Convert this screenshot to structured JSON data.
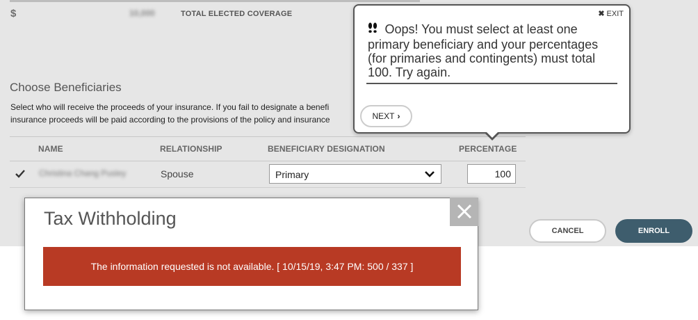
{
  "coverage": {
    "currency": "$",
    "amount": "10,000",
    "label": "TOTAL ELECTED COVERAGE"
  },
  "beneficiaries": {
    "title": "Choose Beneficiaries",
    "description_line1": "Select who will receive the proceeds of your insurance. If you fail to designate a benefi",
    "description_line2": "insurance proceeds will be paid according to the provisions of the policy and insurance"
  },
  "table": {
    "headers": [
      "NAME",
      "RELATIONSHIP",
      "BENEFICIARY DESIGNATION",
      "PERCENTAGE"
    ],
    "rows": [
      {
        "name": "Christina Chang Pusley",
        "relationship": "Spouse",
        "designation": "Primary",
        "percentage": "100"
      }
    ]
  },
  "actions": {
    "cancel": "CANCEL",
    "enroll": "ENROLL"
  },
  "tooltip": {
    "exit_label": "EXIT",
    "message": "Oops! You must select at least one primary beneficiary and your percentages (for primaries and contingents) must total 100. Try again.",
    "next_label": "NEXT"
  },
  "modal": {
    "title": "Tax Withholding",
    "error": "The information requested is not available. [ 10/15/19, 3:47 PM: 500 / 337 ]"
  },
  "colors": {
    "enroll_bg": "#3e5d6d",
    "error_bg": "#b83a24",
    "page_bg": "#e6e6e6"
  }
}
